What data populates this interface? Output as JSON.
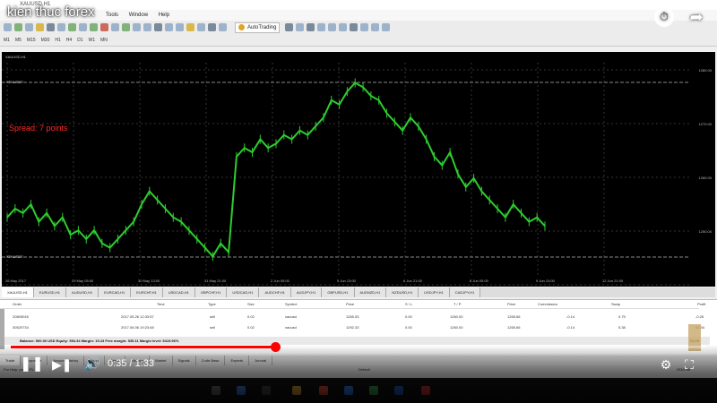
{
  "video": {
    "title": "kien thuc forex",
    "progress": 0.38,
    "time_current": "0:35",
    "time_separator": " / ",
    "time_total": "1:33",
    "accent_color": "#ff0000"
  },
  "app": {
    "window_title": "XAUUSD,H1",
    "menu": [
      "Tools",
      "Window",
      "Help"
    ],
    "toolbar": {
      "autotrading_label": "AutoTrading",
      "timeframes": [
        "M1",
        "M5",
        "M15",
        "M30",
        "H1",
        "H4",
        "D1",
        "W1",
        "MN"
      ]
    }
  },
  "chart": {
    "header": "XAUUSD,H1",
    "overlay_text": "Spread: 7 points",
    "overlay_color": "#ff2a2a",
    "line_labels": [
      "XTKUSDT",
      "XTKUSDT"
    ],
    "price_ticks": [
      "1280.00",
      "1270.00",
      "1260.00",
      "1250.00"
    ],
    "time_ticks": [
      "26 May 2017",
      "29 May 05:00",
      "30 May 13:00",
      "31 May 21:00",
      "2 Jun 05:00",
      "5 Jun 13:00",
      "6 Jun 21:00",
      "8 Jun 05:00",
      "9 Jun 13:00",
      "12 Jun 21:00"
    ],
    "series_color": "#2ecc2e",
    "values": [
      1256,
      1258,
      1257,
      1259,
      1255,
      1257,
      1254,
      1256,
      1252,
      1253,
      1251,
      1253,
      1250,
      1249,
      1251,
      1253,
      1255,
      1259,
      1262,
      1260,
      1258,
      1256,
      1255,
      1253,
      1251,
      1249,
      1247,
      1250,
      1248,
      1270,
      1272,
      1271,
      1274,
      1272,
      1273,
      1275,
      1274,
      1276,
      1275,
      1277,
      1279,
      1283,
      1282,
      1285,
      1287,
      1286,
      1284,
      1283,
      1280,
      1278,
      1276,
      1279,
      1277,
      1274,
      1270,
      1268,
      1271,
      1266,
      1263,
      1265,
      1262,
      1260,
      1258,
      1256,
      1259,
      1257,
      1255,
      1256,
      1254
    ]
  },
  "symbol_tabs": [
    "XAUUSD,H1",
    "EURUSD,H1",
    "AUDUSD,H1",
    "EURCAD,H1",
    "EURCHF,H1",
    "USDCAD,H1",
    "GBPCHF,H1",
    "USDCAD,H1",
    "AUDCHF,H1",
    "AUDJPY,H1",
    "GBPUSD,H1",
    "AUDNZD,H1",
    "NZDUSD,H1",
    "USDJPY,H1",
    "CADJPY,H1"
  ],
  "terminal": {
    "columns": [
      "Order",
      "Time",
      "Type",
      "Size",
      "Symbol",
      "Price",
      "S / L",
      "T / P",
      "Price",
      "Commission",
      "Swap",
      "Profit"
    ],
    "rows": [
      [
        "20805045",
        "2017.05.26 12:33:57",
        "sell",
        "0.02",
        "xauusd",
        "1265.53",
        "0.00",
        "1260.00",
        "1265.66",
        "-0.14",
        "0.75",
        "-0.26"
      ],
      [
        "30520734",
        "2017.06.06 19:23:48",
        "sell",
        "0.02",
        "xauusd",
        "1292.33",
        "0.00",
        "1260.00",
        "1265.66",
        "-0.14",
        "5.38",
        "53.34"
      ]
    ],
    "balance_line": "Balance: 500.00 USD  Equity: 554.34  Margin: 19.23  Free margin: 535.11  Margin level: 5419.96%",
    "total_profit": "53.08",
    "tabs": [
      "Trade",
      "Exposure",
      "Account History",
      "News",
      "Alerts",
      "Mailbox",
      "Market",
      "Signals",
      "Code Base",
      "Experts",
      "Journal"
    ]
  },
  "status": {
    "left": "For Help, press F1",
    "center": "Default",
    "right": "203/3 kb"
  }
}
